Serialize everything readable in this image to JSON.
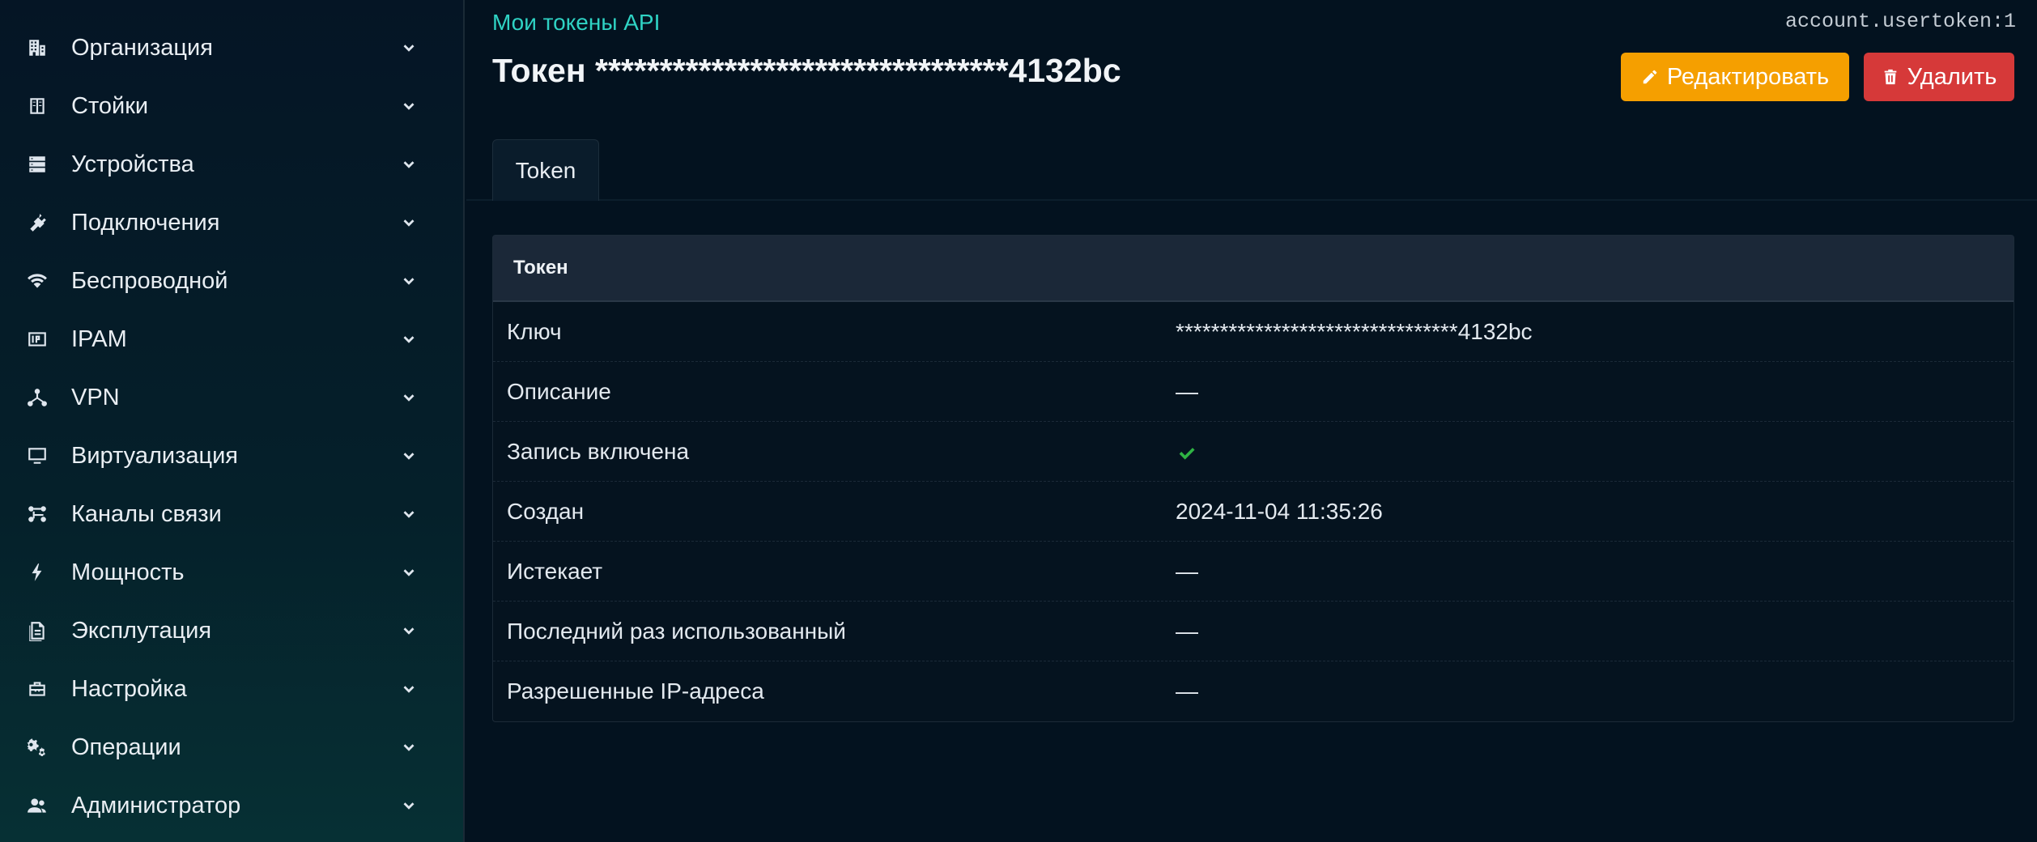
{
  "sidebar": {
    "items": [
      {
        "label": "Организация",
        "icon": "building-icon"
      },
      {
        "label": "Стойки",
        "icon": "rack-icon"
      },
      {
        "label": "Устройства",
        "icon": "server-icon"
      },
      {
        "label": "Подключения",
        "icon": "plug-icon"
      },
      {
        "label": "Беспроводной",
        "icon": "wifi-icon"
      },
      {
        "label": "IPAM",
        "icon": "ipam-icon"
      },
      {
        "label": "VPN",
        "icon": "vpn-icon"
      },
      {
        "label": "Виртуализация",
        "icon": "monitor-icon"
      },
      {
        "label": "Каналы связи",
        "icon": "circuit-icon"
      },
      {
        "label": "Мощность",
        "icon": "lightning-icon"
      },
      {
        "label": "Эксплутация",
        "icon": "document-icon"
      },
      {
        "label": "Настройка",
        "icon": "toolbox-icon"
      },
      {
        "label": "Операции",
        "icon": "cogs-icon"
      },
      {
        "label": "Администратор",
        "icon": "users-icon"
      }
    ]
  },
  "header": {
    "breadcrumb": "Мои токены API",
    "object_id": "account.usertoken:1",
    "title": "Токен ********************************4132bc",
    "edit_label": "Редактировать",
    "delete_label": "Удалить"
  },
  "tabs": [
    {
      "label": "Token"
    }
  ],
  "card": {
    "title": "Токен",
    "rows": [
      {
        "label": "Ключ",
        "value": "********************************4132bc"
      },
      {
        "label": "Описание",
        "value": "—"
      },
      {
        "label": "Запись включена",
        "value": ""
      },
      {
        "label": "Создан",
        "value": "2024-11-04 11:35:26"
      },
      {
        "label": "Истекает",
        "value": "—"
      },
      {
        "label": "Последний раз использованный",
        "value": "—"
      },
      {
        "label": "Разрешенные IP-адреса",
        "value": "—"
      }
    ]
  },
  "colors": {
    "accent": "#2fd3c4",
    "edit": "#f59f00",
    "delete": "#d63939",
    "success": "#2fb344"
  }
}
